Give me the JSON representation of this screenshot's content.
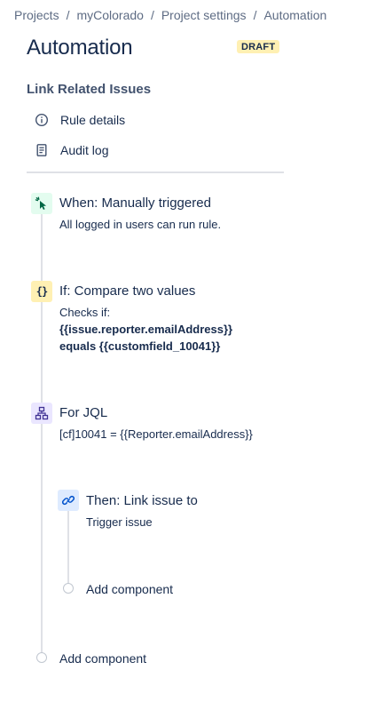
{
  "breadcrumb": {
    "items": [
      "Projects",
      "myColorado",
      "Project settings",
      "Automation"
    ],
    "separator": "/"
  },
  "page": {
    "title": "Automation",
    "badge": "DRAFT"
  },
  "rule": {
    "name": "Link Related Issues"
  },
  "menu": {
    "rule_details": "Rule details",
    "audit_log": "Audit log"
  },
  "components": {
    "trigger": {
      "title": "When: Manually triggered",
      "desc": "All logged in users can run rule.",
      "icon": "cursor-click-icon",
      "color": "#e3fcef"
    },
    "condition": {
      "title": "If: Compare two values",
      "desc_line1": "Checks if:",
      "desc_line2": "{{issue.reporter.emailAddress}}",
      "desc_line3": "equals {{customfield_10041}}",
      "icon": "braces-icon",
      "color": "#fff0b3"
    },
    "branch": {
      "title": "For JQL",
      "desc": "[cf]10041 = {{Reporter.emailAddress}}",
      "icon": "hierarchy-icon",
      "color": "#eae6ff"
    },
    "action": {
      "title": "Then: Link issue to",
      "desc": "Trigger issue",
      "icon": "link-icon",
      "color": "#deebff"
    }
  },
  "add_component": {
    "inner_label": "Add component",
    "outer_label": "Add component"
  }
}
